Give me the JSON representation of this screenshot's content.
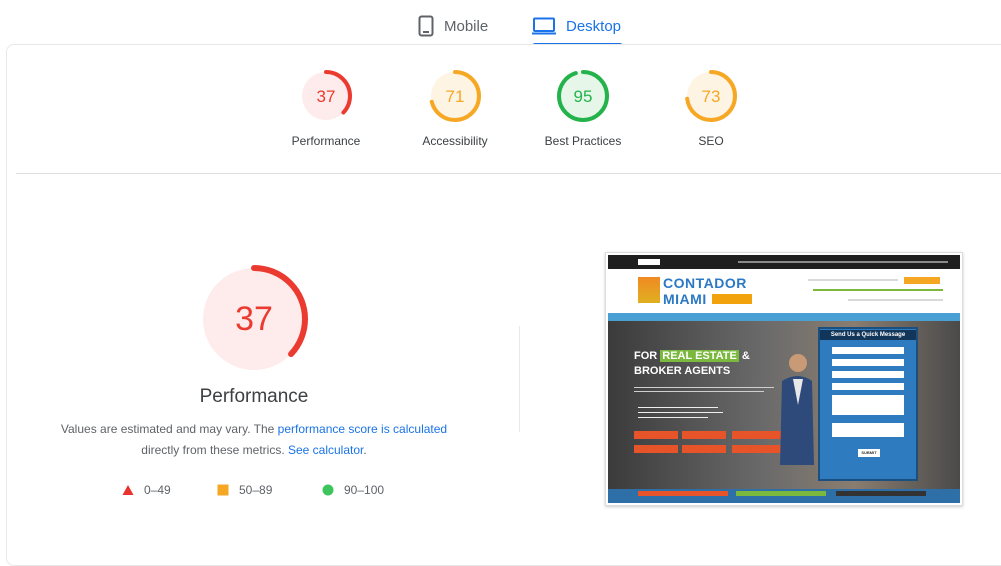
{
  "tabs": {
    "mobile": "Mobile",
    "desktop": "Desktop",
    "active": "desktop"
  },
  "scores": [
    {
      "value": "37",
      "label": "Performance",
      "status": "fail",
      "fraction": 0.37
    },
    {
      "value": "71",
      "label": "Accessibility",
      "status": "average",
      "fraction": 0.71
    },
    {
      "value": "95",
      "label": "Best Practices",
      "status": "pass",
      "fraction": 0.95
    },
    {
      "value": "73",
      "label": "SEO",
      "status": "average",
      "fraction": 0.73
    }
  ],
  "main": {
    "score": "37",
    "fraction": 0.37,
    "title": "Performance",
    "note_pre": "Values are estimated and may vary. The ",
    "note_link1": "performance score is calculated",
    "note_mid": " directly from these metrics. ",
    "note_link2": "See calculator",
    "note_post": "."
  },
  "legend": [
    {
      "shape": "triangle",
      "range": "0–49",
      "color": "#e8332e"
    },
    {
      "shape": "square",
      "range": "50–89",
      "color": "#f5a623"
    },
    {
      "shape": "circle",
      "range": "90–100",
      "color": "#3ec45c"
    }
  ],
  "colors": {
    "fail": "#eb3b30",
    "fail_bg": "#fdeceb",
    "average": "#f6a723",
    "average_bg": "#fef4e4",
    "pass": "#23b34a",
    "pass_bg": "#e6f7ea",
    "accent": "#1a73e8"
  },
  "screenshot": {
    "logo_line1": "CONTADOR",
    "logo_line2": "MIAMI",
    "hero_line1a": "FOR ",
    "hero_line1b": "REAL ESTATE",
    "hero_line1c": " &",
    "hero_line2": "BROKER AGENTS",
    "form_title": "Send Us a Quick Message",
    "submit": "SUBMIT"
  }
}
